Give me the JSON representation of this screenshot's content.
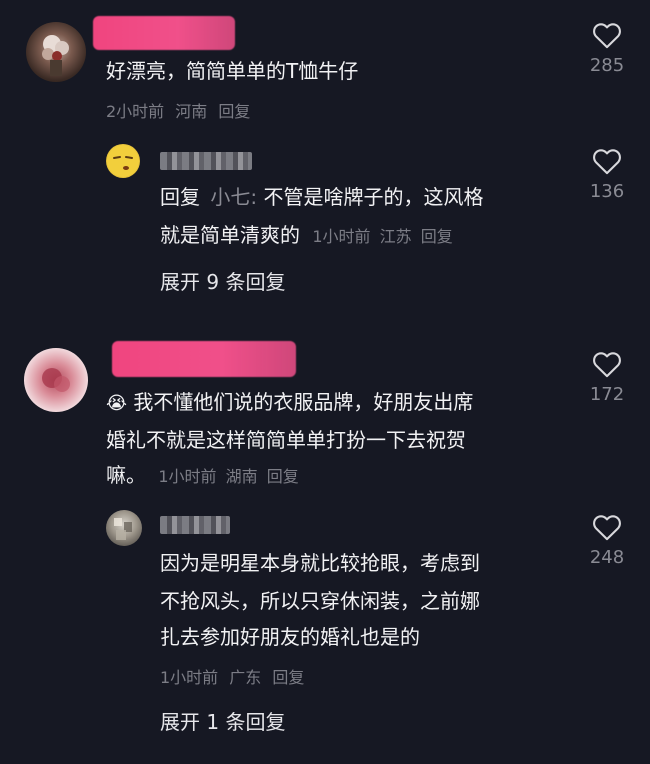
{
  "comments": [
    {
      "text": "好漂亮，简简单单的T恤牛仔",
      "time": "2小时前",
      "location": "河南",
      "reply": "回复",
      "likes": "285",
      "replies": [
        {
          "prefix": "回复",
          "mention": "小七:",
          "text_line1": "不管是啥牌子的，这风格",
          "text_line2": "就是简单清爽的",
          "time": "1小时前",
          "location": "江苏",
          "reply": "回复",
          "likes": "136"
        }
      ],
      "expand": "展开 9 条回复"
    },
    {
      "emoji": "😭",
      "text_line1": "我不懂他们说的衣服品牌，好朋友出席",
      "text_line2": "婚礼不就是这样简简单单打扮一下去祝贺",
      "text_line3": "嘛。",
      "time": "1小时前",
      "location": "湖南",
      "reply": "回复",
      "likes": "172",
      "replies": [
        {
          "text_line1": "因为是明星本身就比较抢眼，考虑到",
          "text_line2": "不抢风头，所以只穿休闲装，之前娜",
          "text_line3": "扎去参加好朋友的婚礼也是的",
          "time": "1小时前",
          "location": "广东",
          "reply": "回复",
          "likes": "248"
        }
      ],
      "expand": "展开 1 条回复"
    }
  ],
  "colors": {
    "background": "#161823",
    "text": "#f2f2f4",
    "meta": "#7c7d86",
    "redaction": "#f0508a"
  }
}
